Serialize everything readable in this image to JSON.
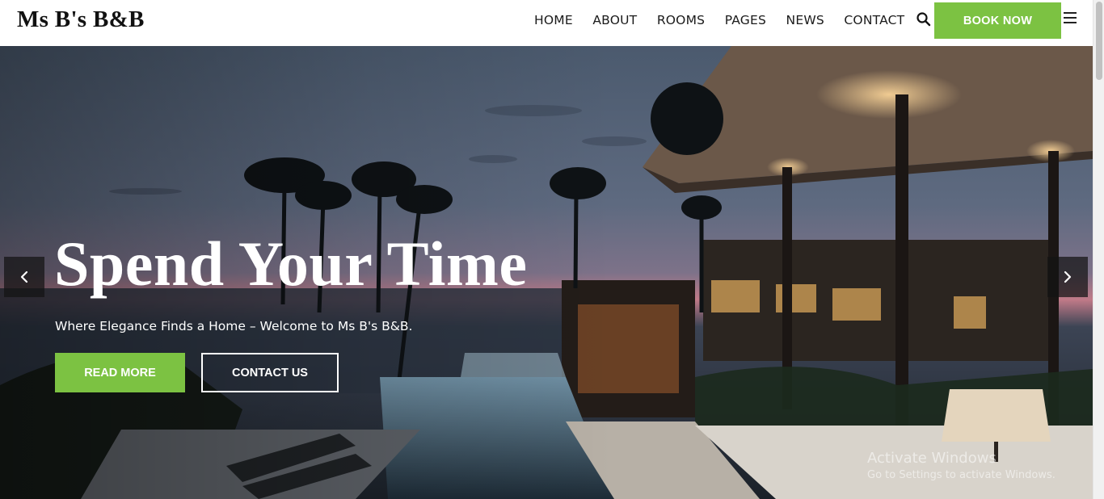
{
  "brand": {
    "logo": "Ms B's B&B"
  },
  "nav": {
    "items": [
      "HOME",
      "ABOUT",
      "ROOMS",
      "PAGES",
      "NEWS",
      "CONTACT"
    ],
    "search_icon": "search-icon",
    "book_label": "BOOK NOW",
    "menu_icon": "hamburger-menu-icon"
  },
  "hero": {
    "title": "Spend Your Time",
    "subtitle": "Where Elegance Finds a Home – Welcome to Ms B's B&B.",
    "read_more_label": "READ MORE",
    "contact_label": "CONTACT US",
    "prev_icon": "chevron-left-icon",
    "next_icon": "chevron-right-icon"
  },
  "colors": {
    "accent": "#7cc242",
    "text_dark": "#1b1b1b"
  },
  "watermark": {
    "line1": "Activate Windows",
    "line2": "Go to Settings to activate Windows."
  }
}
